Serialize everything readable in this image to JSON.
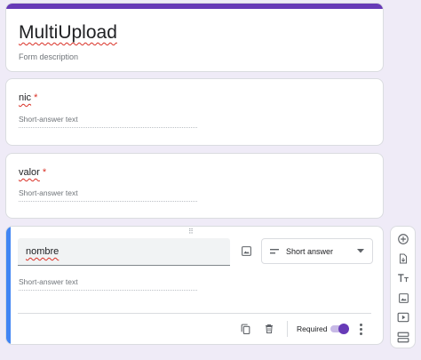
{
  "header": {
    "title": "MultiUpload",
    "description_placeholder": "Form description"
  },
  "questions": [
    {
      "title": "nic",
      "required_mark": "*",
      "answer_placeholder": "Short-answer text"
    },
    {
      "title": "valor",
      "required_mark": "*",
      "answer_placeholder": "Short-answer text"
    }
  ],
  "active_question": {
    "drag_handle": "⠿",
    "title": "nombre",
    "type_label": "Short answer",
    "answer_placeholder": "Short-answer text",
    "required_label": "Required",
    "required_on": true
  },
  "colors": {
    "accent": "#673ab7",
    "active_bar": "#4285f4",
    "required_star": "#d93025",
    "background": "#efebf7"
  },
  "icons": {
    "image": "image-icon",
    "short_answer": "short-text-icon",
    "dropdown": "caret-down-icon",
    "copy": "copy-icon",
    "delete": "trash-icon",
    "more": "more-vert-icon",
    "toolbar": [
      "add-circle-icon",
      "import-icon",
      "title-text-icon",
      "image-icon",
      "video-icon",
      "section-icon"
    ]
  }
}
